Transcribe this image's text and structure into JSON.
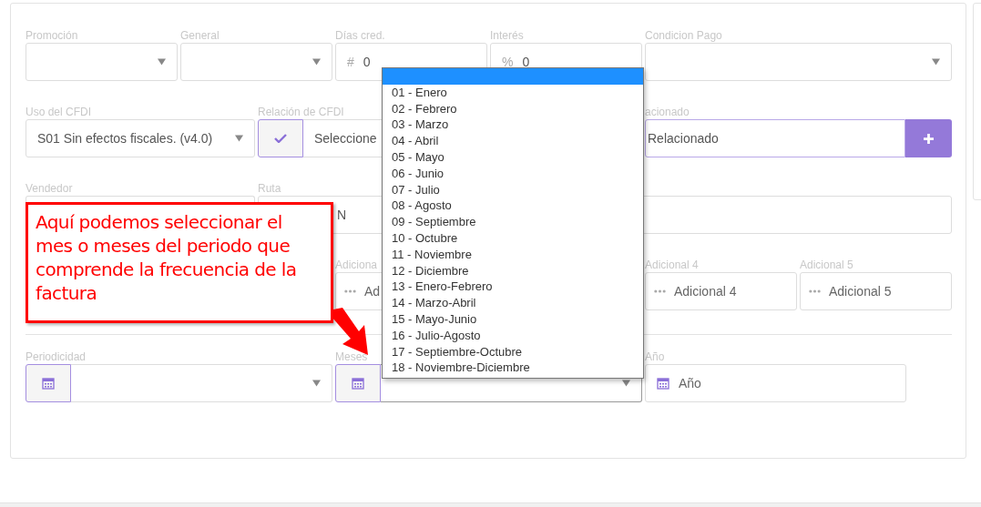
{
  "rows": [
    [
      {
        "kind": "select",
        "label": "Promoción"
      },
      {
        "kind": "select",
        "label": "General"
      },
      {
        "kind": "prefixed",
        "label": "Días cred.",
        "prefix": "#",
        "value": "0"
      },
      {
        "kind": "prefixed",
        "label": "Interés",
        "prefix": "%",
        "value": "0"
      },
      {
        "kind": "select",
        "label": "Condicion Pago"
      }
    ],
    [
      {
        "kind": "select",
        "label": "Uso del CFDI",
        "value": "S01 Sin efectos fiscales. (v4.0)"
      },
      {
        "kind": "check_select",
        "label": "Relación de CFDI",
        "value": "Seleccione"
      },
      {
        "kind": "add_field",
        "label": "acionado",
        "value": "Relacionado"
      }
    ],
    [
      {
        "kind": "text",
        "label": "Vendedor"
      },
      {
        "kind": "partial_text",
        "label": "Ruta",
        "value": "N"
      }
    ],
    [
      {
        "kind": "dots",
        "label": "Adiciona",
        "placeholder": "Ad"
      },
      {
        "kind": "dots",
        "label": "Adicional 4",
        "placeholder": "Adicional 4"
      },
      {
        "kind": "dots",
        "label": "Adicional 5",
        "placeholder": "Adicional 5"
      }
    ],
    [
      {
        "kind": "calendar_select",
        "label": "Periodicidad",
        "open": false
      },
      {
        "kind": "calendar_select",
        "label": "Meses",
        "open": true
      },
      {
        "kind": "calendar_input",
        "label": "Año",
        "placeholder": "Año"
      }
    ]
  ],
  "months_dropdown": {
    "blank_highlighted": true,
    "options": [
      {
        "label": "01 - Enero",
        "selected": false
      },
      {
        "label": "02 - Febrero",
        "selected": false
      },
      {
        "label": "03 - Marzo",
        "selected": false
      },
      {
        "label": "04 - Abril",
        "selected": false
      },
      {
        "label": "05 - Mayo",
        "selected": false
      },
      {
        "label": "06 - Junio",
        "selected": false
      },
      {
        "label": "07 - Julio",
        "selected": false
      },
      {
        "label": "08 - Agosto",
        "selected": false
      },
      {
        "label": "09 - Septiembre",
        "selected": false
      },
      {
        "label": "10 - Octubre",
        "selected": false
      },
      {
        "label": "11 - Noviembre",
        "selected": false
      },
      {
        "label": "12 - Diciembre",
        "selected": false
      },
      {
        "label": "13 - Enero-Febrero",
        "selected": false
      },
      {
        "label": "14 - Marzo-Abril",
        "selected": false
      },
      {
        "label": "15 - Mayo-Junio",
        "selected": false
      },
      {
        "label": "16 - Julio-Agosto",
        "selected": false
      },
      {
        "label": "17 - Septiembre-Octubre",
        "selected": false
      },
      {
        "label": "18 - Noviembre-Diciembre",
        "selected": false
      }
    ]
  },
  "callout": {
    "text": "Aquí podemos seleccionar el mes o meses del periodo que comprende la frecuencia de la factura"
  }
}
